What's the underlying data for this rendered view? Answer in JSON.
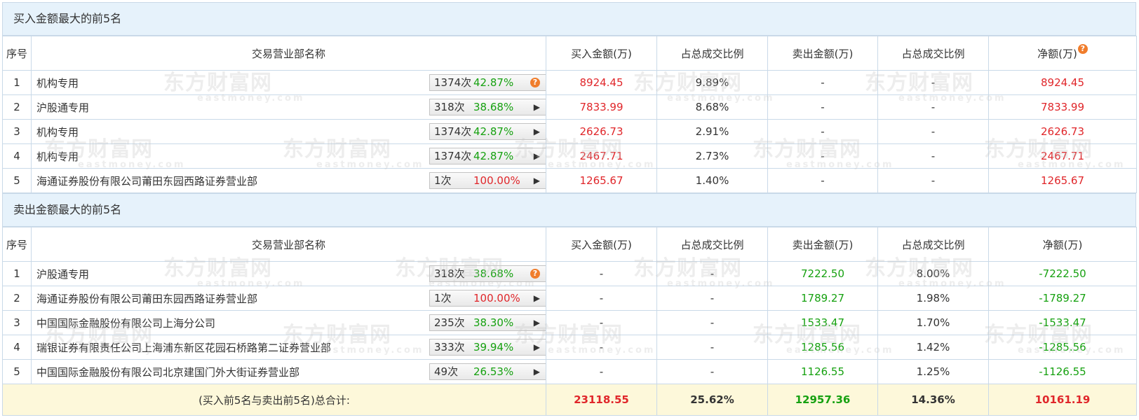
{
  "colors": {
    "red": "#e0262a",
    "green": "#16a110",
    "header_bg": "#e6f2fb",
    "total_bg": "#fdf8da",
    "question_icon": "#f07d2c"
  },
  "watermark": {
    "cn": "东方财富网",
    "en": "eastmoney.com"
  },
  "columns": {
    "idx": "序号",
    "name": "交易营业部名称",
    "buy": "买入金额(万)",
    "buy_ratio": "占总成交比例",
    "sell": "卖出金额(万)",
    "sell_ratio": "占总成交比例",
    "net": "净额(万)"
  },
  "buy_top5": {
    "title": "买入金额最大的前5名",
    "rows": [
      {
        "idx": "1",
        "name": "机构专用",
        "times": "1374次",
        "rate": "42.87%",
        "rate_color": "green",
        "icon": "question-icon",
        "buy": "8924.45",
        "buy_ratio": "9.89%",
        "sell": "-",
        "sell_ratio": "-",
        "net": "8924.45"
      },
      {
        "idx": "2",
        "name": "沪股通专用",
        "times": "318次",
        "rate": "38.68%",
        "rate_color": "green",
        "icon": "arrow-right-icon",
        "buy": "7833.99",
        "buy_ratio": "8.68%",
        "sell": "-",
        "sell_ratio": "-",
        "net": "7833.99"
      },
      {
        "idx": "3",
        "name": "机构专用",
        "times": "1374次",
        "rate": "42.87%",
        "rate_color": "green",
        "icon": "arrow-right-icon",
        "buy": "2626.73",
        "buy_ratio": "2.91%",
        "sell": "-",
        "sell_ratio": "-",
        "net": "2626.73"
      },
      {
        "idx": "4",
        "name": "机构专用",
        "times": "1374次",
        "rate": "42.87%",
        "rate_color": "green",
        "icon": "arrow-right-icon",
        "buy": "2467.71",
        "buy_ratio": "2.73%",
        "sell": "-",
        "sell_ratio": "-",
        "net": "2467.71"
      },
      {
        "idx": "5",
        "name": "海通证券股份有限公司莆田东园西路证券营业部",
        "times": "1次",
        "rate": "100.00%",
        "rate_color": "red",
        "icon": "arrow-right-icon",
        "buy": "1265.67",
        "buy_ratio": "1.40%",
        "sell": "-",
        "sell_ratio": "-",
        "net": "1265.67"
      }
    ]
  },
  "sell_top5": {
    "title": "卖出金额最大的前5名",
    "rows": [
      {
        "idx": "1",
        "name": "沪股通专用",
        "times": "318次",
        "rate": "38.68%",
        "rate_color": "green",
        "icon": "question-icon",
        "buy": "-",
        "buy_ratio": "-",
        "sell": "7222.50",
        "sell_ratio": "8.00%",
        "net": "-7222.50"
      },
      {
        "idx": "2",
        "name": "海通证券股份有限公司莆田东园西路证券营业部",
        "times": "1次",
        "rate": "100.00%",
        "rate_color": "red",
        "icon": "arrow-right-icon",
        "buy": "-",
        "buy_ratio": "-",
        "sell": "1789.27",
        "sell_ratio": "1.98%",
        "net": "-1789.27"
      },
      {
        "idx": "3",
        "name": "中国国际金融股份有限公司上海分公司",
        "times": "235次",
        "rate": "38.30%",
        "rate_color": "green",
        "icon": "arrow-right-icon",
        "buy": "-",
        "buy_ratio": "-",
        "sell": "1533.47",
        "sell_ratio": "1.70%",
        "net": "-1533.47"
      },
      {
        "idx": "4",
        "name": "瑞银证券有限责任公司上海浦东新区花园石桥路第二证券营业部",
        "times": "333次",
        "rate": "39.94%",
        "rate_color": "green",
        "icon": "arrow-right-icon",
        "buy": "-",
        "buy_ratio": "-",
        "sell": "1285.56",
        "sell_ratio": "1.42%",
        "net": "-1285.56"
      },
      {
        "idx": "5",
        "name": "中国国际金融股份有限公司北京建国门外大街证券营业部",
        "times": "49次",
        "rate": "26.53%",
        "rate_color": "green",
        "icon": "arrow-right-icon",
        "buy": "-",
        "buy_ratio": "-",
        "sell": "1126.55",
        "sell_ratio": "1.25%",
        "net": "-1126.55"
      }
    ]
  },
  "total": {
    "label": "(买入前5名与卖出前5名)总合计:",
    "buy": "23118.55",
    "buy_ratio": "25.62%",
    "sell": "12957.36",
    "sell_ratio": "14.36%",
    "net": "10161.19"
  }
}
